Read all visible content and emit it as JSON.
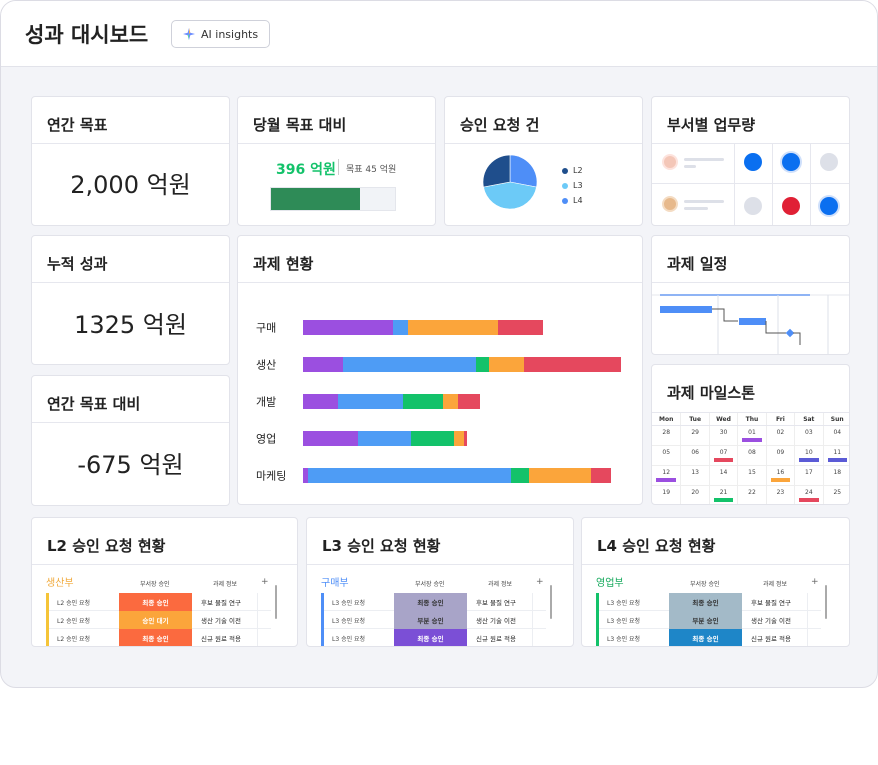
{
  "header": {
    "title": "성과 대시보드",
    "ai_button": "AI insights"
  },
  "annual_goal": {
    "title": "연간 목표",
    "value": "2,000 억원"
  },
  "monthly": {
    "title": "당월 목표 대비",
    "value": "396 억원",
    "target": "목표 45 억원",
    "progress": 0.72,
    "bar_color": "#2e8b57"
  },
  "approvals": {
    "title": "승인 요청 건",
    "legend": [
      {
        "label": "L2",
        "color": "#1f4e8c"
      },
      {
        "label": "L3",
        "color": "#6ccaf7"
      },
      {
        "label": "L4",
        "color": "#4e8ef7"
      }
    ]
  },
  "workload": {
    "title": "부서별 업무량"
  },
  "cumulative": {
    "title": "누적 성과",
    "value": "1325 억원"
  },
  "vs_annual": {
    "title": "연간 목표 대비",
    "value": "-675 억원"
  },
  "tasks": {
    "title": "과제 현황"
  },
  "schedule": {
    "title": "과제 일정"
  },
  "milestone": {
    "title": "과제 마일스톤",
    "days": [
      "Mon",
      "Tue",
      "Wed",
      "Thu",
      "Fri",
      "Sat",
      "Sun"
    ],
    "weeks": [
      [
        "28",
        "29",
        "30",
        "01",
        "02",
        "03",
        "04"
      ],
      [
        "05",
        "06",
        "07",
        "08",
        "09",
        "10",
        "11"
      ],
      [
        "12",
        "13",
        "14",
        "15",
        "16",
        "17",
        "18"
      ],
      [
        "19",
        "20",
        "21",
        "22",
        "23",
        "24",
        "25"
      ]
    ]
  },
  "l2": {
    "title": "L2 승인 요청 현황",
    "dept": "생산부",
    "col1": "부서장 승인",
    "col2": "과제 정보",
    "plus": "+",
    "rows": [
      {
        "name": "L2 승인 요청",
        "status": "최종 승인",
        "info": "후보 물질 연구"
      },
      {
        "name": "L2 승인 요청",
        "status": "승인 대기",
        "info": "생산 기술 이전"
      },
      {
        "name": "L2 승인 요청",
        "status": "최종 승인",
        "info": "신규 원료 적용"
      }
    ]
  },
  "l3": {
    "title": "L3 승인 요청 현황",
    "dept": "구매부",
    "col1": "부서장 승인",
    "col2": "과제 정보",
    "plus": "+",
    "rows": [
      {
        "name": "L3 승인 요청",
        "status": "최종 승인",
        "info": "후보 물질 연구"
      },
      {
        "name": "L3 승인 요청",
        "status": "부분 승인",
        "info": "생산 기술 이전"
      },
      {
        "name": "L3 승인 요청",
        "status": "최종 승인",
        "info": "신규 원료 적용"
      }
    ]
  },
  "l4": {
    "title": "L4 승인 요청 현황",
    "dept": "영업부",
    "col1": "부서장 승인",
    "col2": "과제 정보",
    "plus": "+",
    "rows": [
      {
        "name": "L3 승인 요청",
        "status": "최종 승인",
        "info": "후보 물질 연구"
      },
      {
        "name": "L3 승인 요청",
        "status": "부분 승인",
        "info": "생산 기술 이전"
      },
      {
        "name": "L3 승인 요청",
        "status": "최종 승인",
        "info": "신규 원료 적용"
      }
    ]
  },
  "chart_data": [
    {
      "type": "pie",
      "series": [
        {
          "name": "L2",
          "value": 28
        },
        {
          "name": "L3",
          "value": 44
        },
        {
          "name": "L4",
          "value": 28
        }
      ],
      "title": "승인 요청 건"
    },
    {
      "type": "bar",
      "stacked": true,
      "orientation": "horizontal",
      "title": "과제 현황",
      "categories": [
        "구매",
        "생산",
        "개발",
        "영업",
        "마케팅"
      ],
      "colors": [
        "#9b4fe0",
        "#4e9cf5",
        "#13c26a",
        "#fba53b",
        "#e5485e"
      ],
      "series": [
        {
          "values": [
            90,
            40,
            35,
            55,
            5
          ]
        },
        {
          "values": [
            15,
            133,
            65,
            53,
            203
          ]
        },
        {
          "values": [
            0,
            13,
            40,
            43,
            18
          ]
        },
        {
          "values": [
            90,
            35,
            15,
            10,
            62
          ]
        },
        {
          "values": [
            45,
            97,
            22,
            3,
            20
          ]
        }
      ]
    }
  ]
}
